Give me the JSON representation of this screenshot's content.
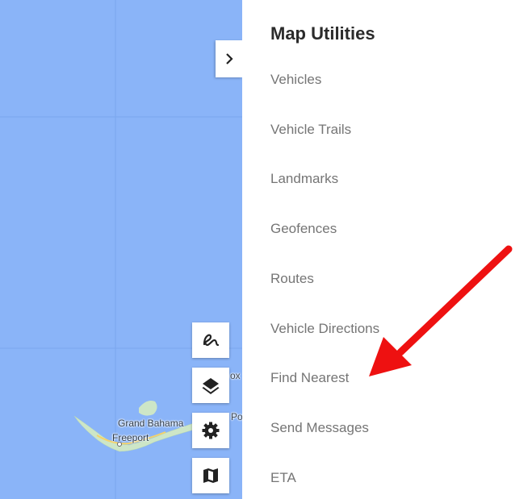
{
  "map": {
    "labels": {
      "grand_bahama": "Grand Bahama",
      "freeport": "Freeport",
      "partial_1": "ox",
      "partial_2": "Po"
    },
    "water_color": "#8ab4f8",
    "land_color": "#cde6c7",
    "road_color": "#f5d36a"
  },
  "collapse_button": {
    "icon": "chevron-right-icon"
  },
  "map_tools": [
    {
      "name": "draw-route-button",
      "icon": "squiggle-icon"
    },
    {
      "name": "layers-button",
      "icon": "layers-icon"
    },
    {
      "name": "settings-button",
      "icon": "gear-icon"
    },
    {
      "name": "map-type-button",
      "icon": "map-icon"
    }
  ],
  "panel": {
    "title": "Map Utilities",
    "items": [
      {
        "label": "Vehicles"
      },
      {
        "label": "Vehicle Trails"
      },
      {
        "label": "Landmarks"
      },
      {
        "label": "Geofences"
      },
      {
        "label": "Routes"
      },
      {
        "label": "Vehicle Directions"
      },
      {
        "label": "Find Nearest"
      },
      {
        "label": "Send Messages"
      },
      {
        "label": "ETA"
      }
    ]
  },
  "annotation": {
    "color": "#ee1111"
  }
}
